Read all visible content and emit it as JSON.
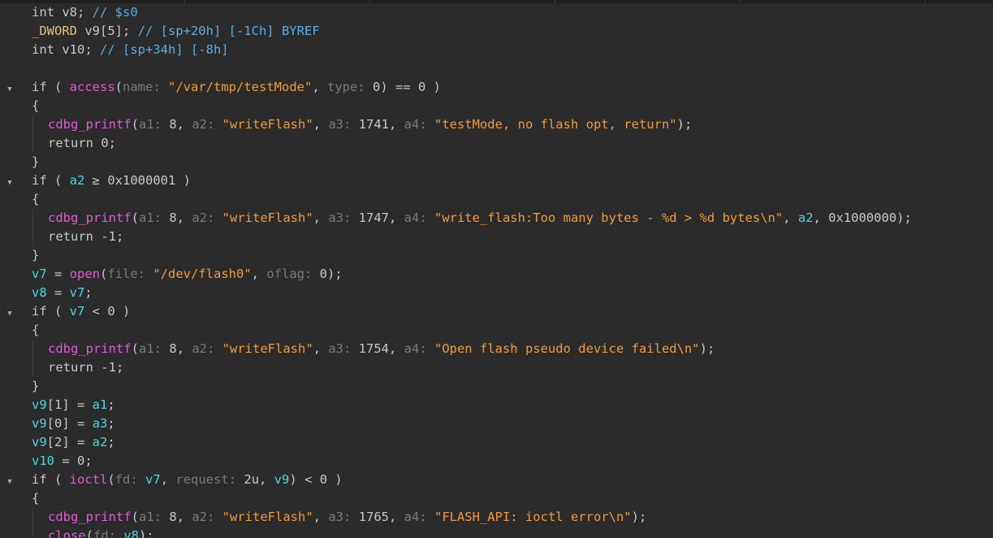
{
  "window": {
    "top_separators": [
      227,
      455,
      683,
      911,
      1139
    ]
  },
  "editor": {
    "lines": [
      {
        "fold": false,
        "indent": 0,
        "tokens": [
          {
            "t": "kw",
            "v": "int "
          },
          {
            "t": "plain",
            "v": "v8; "
          },
          {
            "t": "cmt",
            "v": "// $s0"
          }
        ]
      },
      {
        "fold": false,
        "indent": 0,
        "tokens": [
          {
            "t": "type",
            "v": "_DWORD "
          },
          {
            "t": "plain",
            "v": "v9[5]; "
          },
          {
            "t": "cmt",
            "v": "// [sp+20h] [-1Ch] BYREF"
          }
        ]
      },
      {
        "fold": false,
        "indent": 0,
        "tokens": [
          {
            "t": "kw",
            "v": "int "
          },
          {
            "t": "plain",
            "v": "v10; "
          },
          {
            "t": "cmt",
            "v": "// [sp+34h] [-8h]"
          }
        ]
      },
      {
        "fold": false,
        "indent": 0,
        "tokens": []
      },
      {
        "fold": true,
        "indent": 0,
        "tokens": [
          {
            "t": "kw",
            "v": "if ( "
          },
          {
            "t": "fn",
            "v": "access"
          },
          {
            "t": "plain",
            "v": "("
          },
          {
            "t": "hint",
            "v": "name: "
          },
          {
            "t": "str",
            "v": "\"/var/tmp/testMode\""
          },
          {
            "t": "plain",
            "v": ", "
          },
          {
            "t": "hint",
            "v": "type: "
          },
          {
            "t": "num",
            "v": "0"
          },
          {
            "t": "plain",
            "v": ") == 0 )"
          }
        ]
      },
      {
        "fold": false,
        "indent": 0,
        "tokens": [
          {
            "t": "plain",
            "v": "{"
          }
        ]
      },
      {
        "fold": false,
        "indent": 1,
        "tokens": [
          {
            "t": "fn",
            "v": "cdbg_printf"
          },
          {
            "t": "plain",
            "v": "("
          },
          {
            "t": "hint",
            "v": "a1: "
          },
          {
            "t": "num",
            "v": "8"
          },
          {
            "t": "plain",
            "v": ", "
          },
          {
            "t": "hint",
            "v": "a2: "
          },
          {
            "t": "str",
            "v": "\"writeFlash\""
          },
          {
            "t": "plain",
            "v": ", "
          },
          {
            "t": "hint",
            "v": "a3: "
          },
          {
            "t": "num",
            "v": "1741"
          },
          {
            "t": "plain",
            "v": ", "
          },
          {
            "t": "hint",
            "v": "a4: "
          },
          {
            "t": "str",
            "v": "\"testMode, no flash opt, return\""
          },
          {
            "t": "plain",
            "v": ");"
          }
        ]
      },
      {
        "fold": false,
        "indent": 1,
        "tokens": [
          {
            "t": "kw",
            "v": "return "
          },
          {
            "t": "num",
            "v": "0"
          },
          {
            "t": "plain",
            "v": ";"
          }
        ]
      },
      {
        "fold": false,
        "indent": 0,
        "tokens": [
          {
            "t": "plain",
            "v": "}"
          }
        ]
      },
      {
        "fold": true,
        "indent": 0,
        "tokens": [
          {
            "t": "kw",
            "v": "if ( "
          },
          {
            "t": "var",
            "v": "a2"
          },
          {
            "t": "plain",
            "v": " ≥ "
          },
          {
            "t": "num",
            "v": "0x1000001"
          },
          {
            "t": "plain",
            "v": " )"
          }
        ]
      },
      {
        "fold": false,
        "indent": 0,
        "tokens": [
          {
            "t": "plain",
            "v": "{"
          }
        ]
      },
      {
        "fold": false,
        "indent": 1,
        "tokens": [
          {
            "t": "fn",
            "v": "cdbg_printf"
          },
          {
            "t": "plain",
            "v": "("
          },
          {
            "t": "hint",
            "v": "a1: "
          },
          {
            "t": "num",
            "v": "8"
          },
          {
            "t": "plain",
            "v": ", "
          },
          {
            "t": "hint",
            "v": "a2: "
          },
          {
            "t": "str",
            "v": "\"writeFlash\""
          },
          {
            "t": "plain",
            "v": ", "
          },
          {
            "t": "hint",
            "v": "a3: "
          },
          {
            "t": "num",
            "v": "1747"
          },
          {
            "t": "plain",
            "v": ", "
          },
          {
            "t": "hint",
            "v": "a4: "
          },
          {
            "t": "str",
            "v": "\"write_flash:Too many bytes - %d > %d bytes\\n\""
          },
          {
            "t": "plain",
            "v": ", "
          },
          {
            "t": "var",
            "v": "a2"
          },
          {
            "t": "plain",
            "v": ", "
          },
          {
            "t": "num",
            "v": "0x1000000"
          },
          {
            "t": "plain",
            "v": ");"
          }
        ]
      },
      {
        "fold": false,
        "indent": 1,
        "tokens": [
          {
            "t": "kw",
            "v": "return "
          },
          {
            "t": "num",
            "v": "-1"
          },
          {
            "t": "plain",
            "v": ";"
          }
        ]
      },
      {
        "fold": false,
        "indent": 0,
        "tokens": [
          {
            "t": "plain",
            "v": "}"
          }
        ]
      },
      {
        "fold": false,
        "indent": 0,
        "tokens": [
          {
            "t": "var",
            "v": "v7"
          },
          {
            "t": "plain",
            "v": " = "
          },
          {
            "t": "fn",
            "v": "open"
          },
          {
            "t": "plain",
            "v": "("
          },
          {
            "t": "hint",
            "v": "file: "
          },
          {
            "t": "str",
            "v": "\"/dev/flash0\""
          },
          {
            "t": "plain",
            "v": ", "
          },
          {
            "t": "hint",
            "v": "oflag: "
          },
          {
            "t": "num",
            "v": "0"
          },
          {
            "t": "plain",
            "v": ");"
          }
        ]
      },
      {
        "fold": false,
        "indent": 0,
        "tokens": [
          {
            "t": "var",
            "v": "v8"
          },
          {
            "t": "plain",
            "v": " = "
          },
          {
            "t": "var",
            "v": "v7"
          },
          {
            "t": "plain",
            "v": ";"
          }
        ]
      },
      {
        "fold": true,
        "indent": 0,
        "tokens": [
          {
            "t": "kw",
            "v": "if ( "
          },
          {
            "t": "var",
            "v": "v7"
          },
          {
            "t": "plain",
            "v": " < 0 )"
          }
        ]
      },
      {
        "fold": false,
        "indent": 0,
        "tokens": [
          {
            "t": "plain",
            "v": "{"
          }
        ]
      },
      {
        "fold": false,
        "indent": 1,
        "tokens": [
          {
            "t": "fn",
            "v": "cdbg_printf"
          },
          {
            "t": "plain",
            "v": "("
          },
          {
            "t": "hint",
            "v": "a1: "
          },
          {
            "t": "num",
            "v": "8"
          },
          {
            "t": "plain",
            "v": ", "
          },
          {
            "t": "hint",
            "v": "a2: "
          },
          {
            "t": "str",
            "v": "\"writeFlash\""
          },
          {
            "t": "plain",
            "v": ", "
          },
          {
            "t": "hint",
            "v": "a3: "
          },
          {
            "t": "num",
            "v": "1754"
          },
          {
            "t": "plain",
            "v": ", "
          },
          {
            "t": "hint",
            "v": "a4: "
          },
          {
            "t": "str",
            "v": "\"Open flash pseudo device failed\\n\""
          },
          {
            "t": "plain",
            "v": ");"
          }
        ]
      },
      {
        "fold": false,
        "indent": 1,
        "tokens": [
          {
            "t": "kw",
            "v": "return "
          },
          {
            "t": "num",
            "v": "-1"
          },
          {
            "t": "plain",
            "v": ";"
          }
        ]
      },
      {
        "fold": false,
        "indent": 0,
        "tokens": [
          {
            "t": "plain",
            "v": "}"
          }
        ]
      },
      {
        "fold": false,
        "indent": 0,
        "tokens": [
          {
            "t": "var",
            "v": "v9"
          },
          {
            "t": "plain",
            "v": "[1] = "
          },
          {
            "t": "var",
            "v": "a1"
          },
          {
            "t": "plain",
            "v": ";"
          }
        ]
      },
      {
        "fold": false,
        "indent": 0,
        "tokens": [
          {
            "t": "var",
            "v": "v9"
          },
          {
            "t": "plain",
            "v": "[0] = "
          },
          {
            "t": "var",
            "v": "a3"
          },
          {
            "t": "plain",
            "v": ";"
          }
        ]
      },
      {
        "fold": false,
        "indent": 0,
        "tokens": [
          {
            "t": "var",
            "v": "v9"
          },
          {
            "t": "plain",
            "v": "[2] = "
          },
          {
            "t": "var",
            "v": "a2"
          },
          {
            "t": "plain",
            "v": ";"
          }
        ]
      },
      {
        "fold": false,
        "indent": 0,
        "tokens": [
          {
            "t": "var",
            "v": "v10"
          },
          {
            "t": "plain",
            "v": " = 0;"
          }
        ]
      },
      {
        "fold": true,
        "indent": 0,
        "tokens": [
          {
            "t": "kw",
            "v": "if ( "
          },
          {
            "t": "fn",
            "v": "ioctl"
          },
          {
            "t": "plain",
            "v": "("
          },
          {
            "t": "hint",
            "v": "fd: "
          },
          {
            "t": "var",
            "v": "v7"
          },
          {
            "t": "plain",
            "v": ", "
          },
          {
            "t": "hint",
            "v": "request: "
          },
          {
            "t": "num",
            "v": "2u"
          },
          {
            "t": "plain",
            "v": ", "
          },
          {
            "t": "var",
            "v": "v9"
          },
          {
            "t": "plain",
            "v": ") < 0 )"
          }
        ]
      },
      {
        "fold": false,
        "indent": 0,
        "tokens": [
          {
            "t": "plain",
            "v": "{"
          }
        ]
      },
      {
        "fold": false,
        "indent": 1,
        "tokens": [
          {
            "t": "fn",
            "v": "cdbg_printf"
          },
          {
            "t": "plain",
            "v": "("
          },
          {
            "t": "hint",
            "v": "a1: "
          },
          {
            "t": "num",
            "v": "8"
          },
          {
            "t": "plain",
            "v": ", "
          },
          {
            "t": "hint",
            "v": "a2: "
          },
          {
            "t": "str",
            "v": "\"writeFlash\""
          },
          {
            "t": "plain",
            "v": ", "
          },
          {
            "t": "hint",
            "v": "a3: "
          },
          {
            "t": "num",
            "v": "1765"
          },
          {
            "t": "plain",
            "v": ", "
          },
          {
            "t": "hint",
            "v": "a4: "
          },
          {
            "t": "str",
            "v": "\"FLASH_API: ioctl error\\n\""
          },
          {
            "t": "plain",
            "v": ");"
          }
        ]
      },
      {
        "fold": false,
        "indent": 1,
        "tokens": [
          {
            "t": "fn",
            "v": "close"
          },
          {
            "t": "plain",
            "v": "("
          },
          {
            "t": "hint",
            "v": "fd: "
          },
          {
            "t": "var",
            "v": "v8"
          },
          {
            "t": "plain",
            "v": ");"
          }
        ]
      }
    ],
    "fold_icon": "chevron-down-icon",
    "fold_glyph": "▼",
    "colors": {
      "background": "#2b2b2b",
      "keyword": "#c8c8c8",
      "type": "#e6c07b",
      "variable": "#4cd7e2",
      "function": "#e35ad6",
      "string": "#f29b3c",
      "param_hint": "#7a7a7a",
      "comment": "#58aee0"
    }
  }
}
